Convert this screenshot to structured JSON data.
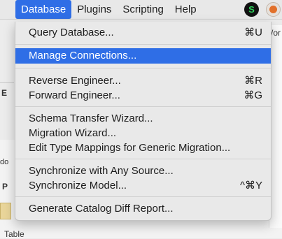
{
  "menubar": {
    "items": [
      {
        "label": "Database",
        "active": true
      },
      {
        "label": "Plugins",
        "active": false
      },
      {
        "label": "Scripting",
        "active": false
      },
      {
        "label": "Help",
        "active": false
      }
    ],
    "status_icons": [
      "green-s-icon",
      "orange-app-icon"
    ]
  },
  "background": {
    "peek_right": "/or",
    "letter_e": "E",
    "text_do": "do",
    "letter_p": "P",
    "table_label": "Table"
  },
  "menu": {
    "items": [
      {
        "label": "Query Database...",
        "shortcut": "⌘U"
      },
      {
        "label": "Manage Connections...",
        "shortcut": "",
        "highlighted": true
      },
      {
        "label": "Reverse Engineer...",
        "shortcut": "⌘R"
      },
      {
        "label": "Forward Engineer...",
        "shortcut": "⌘G"
      },
      {
        "label": "Schema Transfer Wizard...",
        "shortcut": ""
      },
      {
        "label": "Migration Wizard...",
        "shortcut": ""
      },
      {
        "label": "Edit Type Mappings for Generic Migration...",
        "shortcut": ""
      },
      {
        "label": "Synchronize with Any Source...",
        "shortcut": ""
      },
      {
        "label": "Synchronize Model...",
        "shortcut": "^⌘Y"
      },
      {
        "label": "Generate Catalog Diff Report...",
        "shortcut": ""
      }
    ]
  },
  "colors": {
    "highlight": "#2f6ee6",
    "menu_bg": "#e9e9e9"
  }
}
